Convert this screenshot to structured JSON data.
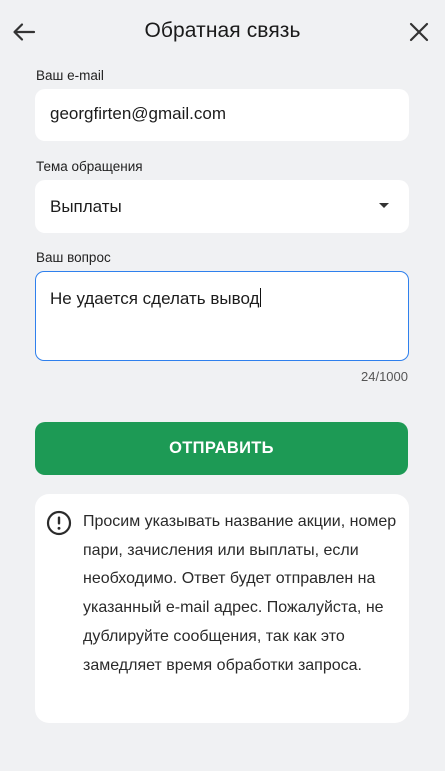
{
  "header": {
    "title": "Обратная связь",
    "back_icon": "arrow-left-icon",
    "close_icon": "close-icon"
  },
  "form": {
    "email": {
      "label": "Ваш e-mail",
      "value": "georgfirten@gmail.com"
    },
    "topic": {
      "label": "Тема обращения",
      "value": "Выплаты",
      "icon": "chevron-down-icon"
    },
    "question": {
      "label": "Ваш вопрос",
      "value": "Не удается сделать вывод",
      "counter": "24/1000"
    },
    "submit_label": "ОТПРАВИТЬ"
  },
  "info": {
    "icon": "alert-circle-icon",
    "text": "Просим указывать название акции, номер пари, зачисления или выплаты, если необходимо. Ответ будет отправлен на указанный e-mail адрес. Пожалуйста, не дублируйте сообщения, так как это замедляет время обработки запроса."
  },
  "colors": {
    "background": "#f0f1f3",
    "accent_green": "#1d9a55",
    "focus_blue": "#2f80ed"
  }
}
